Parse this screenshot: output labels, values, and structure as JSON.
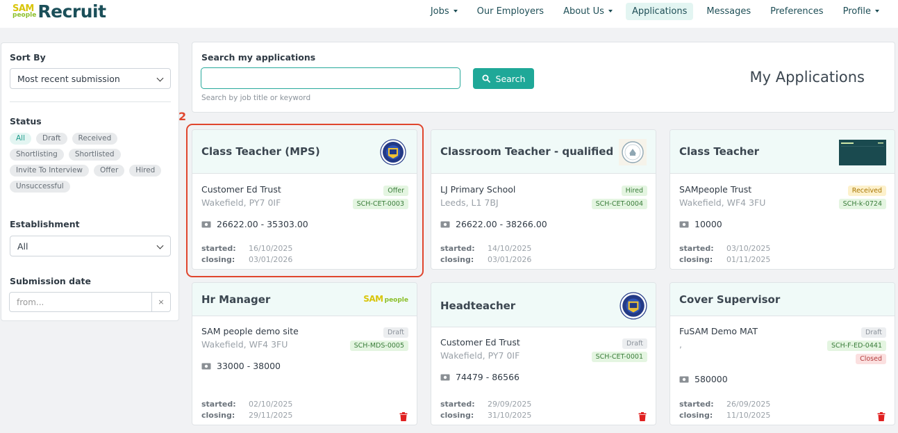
{
  "nav": {
    "logo_sam": "SAM",
    "logo_people": "people",
    "logo_recruit": "Recruit",
    "items": [
      {
        "label": "Jobs",
        "dropdown": true,
        "active": false
      },
      {
        "label": "Our Employers",
        "dropdown": false,
        "active": false
      },
      {
        "label": "About Us",
        "dropdown": true,
        "active": false
      },
      {
        "label": "Applications",
        "dropdown": false,
        "active": true
      },
      {
        "label": "Messages",
        "dropdown": false,
        "active": false
      },
      {
        "label": "Preferences",
        "dropdown": false,
        "active": false
      },
      {
        "label": "Profile",
        "dropdown": true,
        "active": false
      }
    ]
  },
  "sidebar": {
    "sort_by_label": "Sort By",
    "sort_by_value": "Most recent submission",
    "status_label": "Status",
    "status_chips": [
      "All",
      "Draft",
      "Received",
      "Shortlisting",
      "Shortlisted",
      "Invite To Interview",
      "Offer",
      "Hired",
      "Unsuccessful"
    ],
    "status_selected": "All",
    "establishment_label": "Establishment",
    "establishment_value": "All",
    "submission_date_label": "Submission date",
    "submission_date_placeholder": "from...",
    "clear_icon": "×"
  },
  "search": {
    "label": "Search my applications",
    "value": "",
    "button_label": "Search",
    "help_text": "Search by job title or keyword"
  },
  "page_title": "My Applications",
  "annotation": {
    "label": "2",
    "color": "#e0452d"
  },
  "colors": {
    "accent": "#1fa898",
    "brand_dark": "#1b4f59",
    "card_header": "#f0faf8",
    "delete": "#e02020"
  },
  "cards": [
    {
      "title": "Class Teacher (MPS)",
      "logo": "school-crest-logo",
      "org": "Customer Ed Trust",
      "location": "Wakefield, PY7 0IF",
      "status": "Offer",
      "reference": "SCH-CET-0003",
      "salary": "26622.00 - 35303.00",
      "started_label": "started:",
      "started": "16/10/2025",
      "closing_label": "closing:",
      "closing": "03/01/2026"
    },
    {
      "title": "Classroom Teacher - qualified",
      "logo": "primary-school-logo",
      "org": "LJ Primary School",
      "location": "Leeds, L1 7BJ",
      "status": "Hired",
      "reference": "SCH-CET-0004",
      "salary": "26622.00 - 38266.00",
      "started_label": "started:",
      "started": "14/10/2025",
      "closing_label": "closing:",
      "closing": "03/01/2026"
    },
    {
      "title": "Class Teacher",
      "logo": "trust-banner-logo",
      "org": "SAMpeople Trust",
      "location": "Wakefield, WF4 3FU",
      "status": "Received",
      "reference": "SCH-k-0724",
      "salary": "10000",
      "started_label": "started:",
      "started": "03/10/2025",
      "closing_label": "closing:",
      "closing": "01/11/2025"
    },
    {
      "title": "Hr Manager",
      "logo": "sam-people-logo",
      "logo_text_sam": "SAM",
      "logo_text_people": "people",
      "org": "SAM people demo site",
      "location": "Wakefield, WF4 3FU",
      "status": "Draft",
      "reference": "SCH-MDS-0005",
      "salary": "33000 - 38000",
      "started_label": "started:",
      "started": "02/10/2025",
      "closing_label": "closing:",
      "closing": "29/11/2025",
      "deletable": true
    },
    {
      "title": "Headteacher",
      "logo": "school-crest-logo",
      "org": "Customer Ed Trust",
      "location": "Wakefield, PY7 0IF",
      "status": "Draft",
      "reference": "SCH-CET-0001",
      "salary": "74479 - 86566",
      "started_label": "started:",
      "started": "29/09/2025",
      "closing_label": "closing:",
      "closing": "31/10/2025",
      "deletable": true
    },
    {
      "title": "Cover Supervisor",
      "logo": "",
      "org": "FuSAM Demo MAT",
      "location": ",",
      "status": "Draft",
      "reference": "SCH-F-ED-0441",
      "extra_status": "Closed",
      "salary": "580000",
      "started_label": "started:",
      "started": "26/09/2025",
      "closing_label": "closing:",
      "closing": "11/10/2025",
      "deletable": true
    }
  ]
}
